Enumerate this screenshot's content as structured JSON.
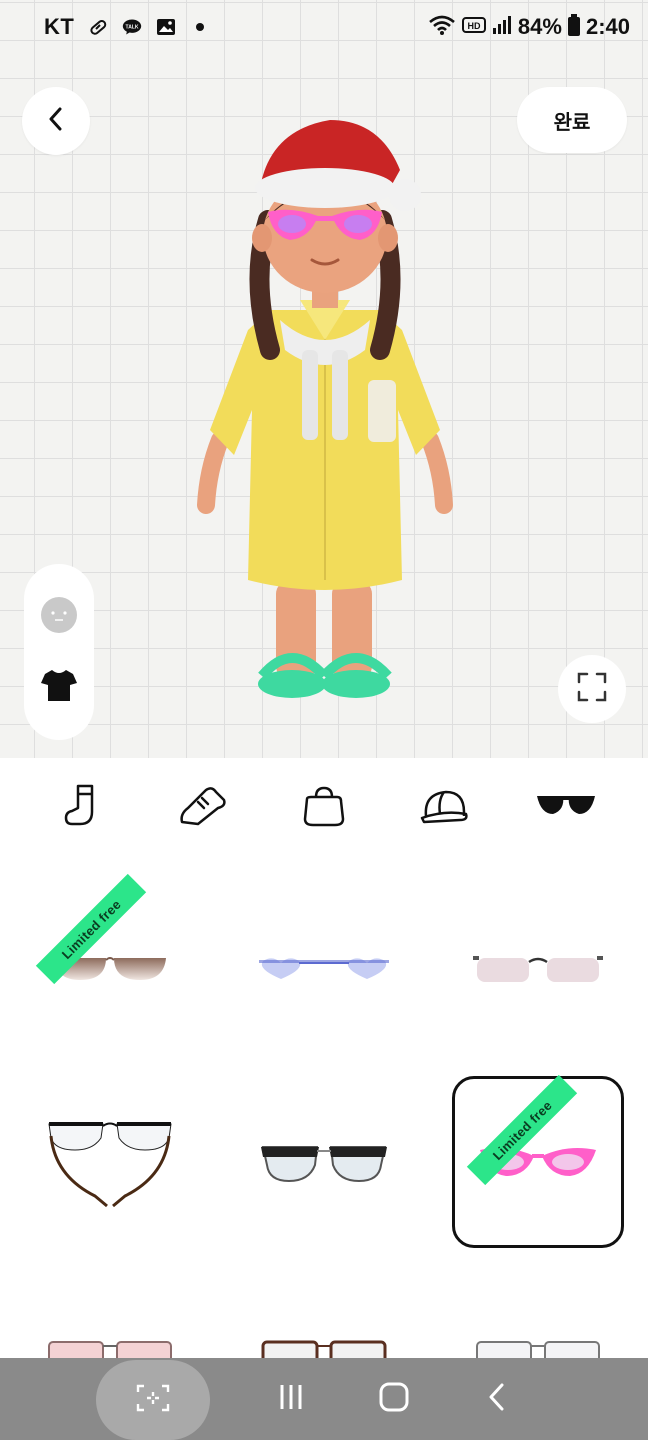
{
  "status_bar": {
    "carrier": "KT",
    "left_icons": [
      "pill-icon",
      "kakaotalk-icon",
      "gallery-icon",
      "dot-icon"
    ],
    "kakaotalk_label": "TALK",
    "right_icons": [
      "wifi-icon",
      "hd-icon",
      "signal-icon",
      "battery-icon"
    ],
    "hd_label": "HD",
    "battery_percent": "84%",
    "time": "2:40"
  },
  "header": {
    "back_icon": "chevron-left-icon",
    "done_label": "완료"
  },
  "side_panel": {
    "items": [
      {
        "name": "face-icon",
        "active": false
      },
      {
        "name": "shirt-icon",
        "active": true
      }
    ]
  },
  "fullscreen_icon": "expand-icon",
  "categories": [
    {
      "name": "sock-icon",
      "active": false
    },
    {
      "name": "sneaker-icon",
      "active": false
    },
    {
      "name": "bag-icon",
      "active": false
    },
    {
      "name": "cap-icon",
      "active": false
    },
    {
      "name": "sunglasses-icon",
      "active": true
    }
  ],
  "items": [
    {
      "name": "brown-gradient-sunglasses",
      "badge": "Limited free",
      "selected": false
    },
    {
      "name": "blue-heart-sunglasses",
      "badge": "",
      "selected": false
    },
    {
      "name": "pink-rimless-sunglasses",
      "badge": "",
      "selected": false
    },
    {
      "name": "half-rim-chain-glasses",
      "badge": "",
      "selected": false
    },
    {
      "name": "black-browline-glasses",
      "badge": "",
      "selected": false
    },
    {
      "name": "pink-cat-eye-sunglasses",
      "badge": "Limited free",
      "selected": true
    },
    {
      "name": "pink-tint-glasses",
      "badge": "",
      "selected": false
    },
    {
      "name": "brown-frame-glasses",
      "badge": "",
      "selected": false
    },
    {
      "name": "silver-frame-glasses",
      "badge": "",
      "selected": false
    }
  ],
  "colors": {
    "badge_green": "#2ce58a",
    "accent_pink": "#ff5fc9",
    "dress_yellow": "#f2dc5a",
    "sandal_green": "#3ed9a0"
  },
  "nav_bar": {
    "buttons": [
      "capture-icon",
      "recent-apps-icon",
      "home-icon",
      "back-icon"
    ]
  }
}
